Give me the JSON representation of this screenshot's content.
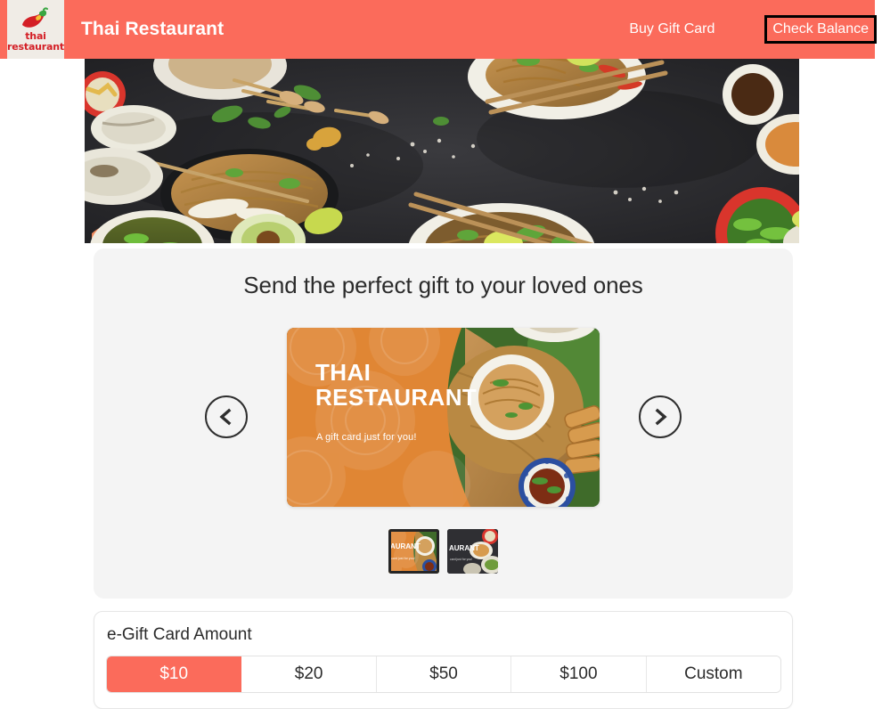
{
  "header": {
    "logo": {
      "icon": "chili-pepper-icon",
      "line1": "thai",
      "line2": "restaurant"
    },
    "brand_name": "Thai Restaurant",
    "nav": [
      {
        "label": "Buy Gift Card",
        "focused": false
      },
      {
        "label": "Check Balance",
        "focused": true
      }
    ],
    "bg_color": "#fb6b5b"
  },
  "hero": {
    "alt": "assorted thai dishes arranged on a dark slate table",
    "bg_color": "#2b2b2e"
  },
  "preview": {
    "heading": "Send the perfect gift to your loved ones",
    "prev_arrow": "chevron-left-icon",
    "next_arrow": "chevron-right-icon",
    "giftcard": {
      "title_line1": "THAI",
      "title_line2": "RESTAURANT",
      "subtitle": "A gift card just for you!",
      "accent_color": "#e08634"
    },
    "thumbnails": [
      {
        "name": "orange-thai-restaurant-card",
        "selected": true,
        "accent": "#e08634"
      },
      {
        "name": "dark-slate-thai-restaurant-card",
        "selected": false,
        "accent": "#3c3c40"
      }
    ]
  },
  "amount": {
    "title": "e-Gift Card Amount",
    "options": [
      {
        "label": "$10",
        "selected": true
      },
      {
        "label": "$20",
        "selected": false
      },
      {
        "label": "$50",
        "selected": false
      },
      {
        "label": "$100",
        "selected": false
      },
      {
        "label": "Custom",
        "selected": false
      }
    ],
    "selected_color": "#fb6b5b"
  }
}
